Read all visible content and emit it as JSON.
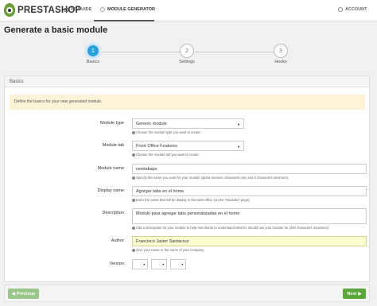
{
  "nav": {
    "logo_text": "PRESTASHOP",
    "ps_guide": "PS GUIDE",
    "module_generator": "MODULE GENERATOR",
    "account": "ACCOUNT"
  },
  "page": {
    "title": "Generate a basic module"
  },
  "steps": [
    {
      "number": "1",
      "label": "Basics"
    },
    {
      "number": "2",
      "label": "Settings"
    },
    {
      "number": "3",
      "label": "Hooks"
    }
  ],
  "panel": {
    "heading": "Basics",
    "alert": "Define the basics for your new generated module."
  },
  "form": {
    "module_type": {
      "label": "Module type",
      "value": "Generic module",
      "help": "Choose the module type you want to create."
    },
    "module_tab": {
      "label": "Module tab",
      "value": "Front Office Features",
      "help": "Choose the module tab you want to create."
    },
    "module_name": {
      "label": "Module name",
      "value": "newtabaps",
      "help": "Specify the name you want for your module (alpha-numeric characters only and 5 characters minimum)."
    },
    "display_name": {
      "label": "Display name",
      "value": "Agregar tabs en el home",
      "help": "Enter the name that will be display in the back-office (on the \"Modules\" page)."
    },
    "description": {
      "label": "Description",
      "value": "Modulo para agregar tabs personalizadas en el home",
      "help": "Add a description for your module to help merchants to understand what he should use your module for (200 characters maximum)."
    },
    "author": {
      "label": "Author",
      "value": "Francisco Javier Santacruz",
      "help": "Give your name or the name of your company."
    },
    "version": {
      "label": "Version"
    }
  },
  "footer": {
    "previous": "Previous",
    "next": "Next"
  },
  "colors": {
    "step_active": "#2aa1d8",
    "alert_bg": "#fff3d7",
    "author_highlight": "#fdfdd2",
    "next_button": "#5aa63a",
    "previous_button": "#9ac58b"
  }
}
